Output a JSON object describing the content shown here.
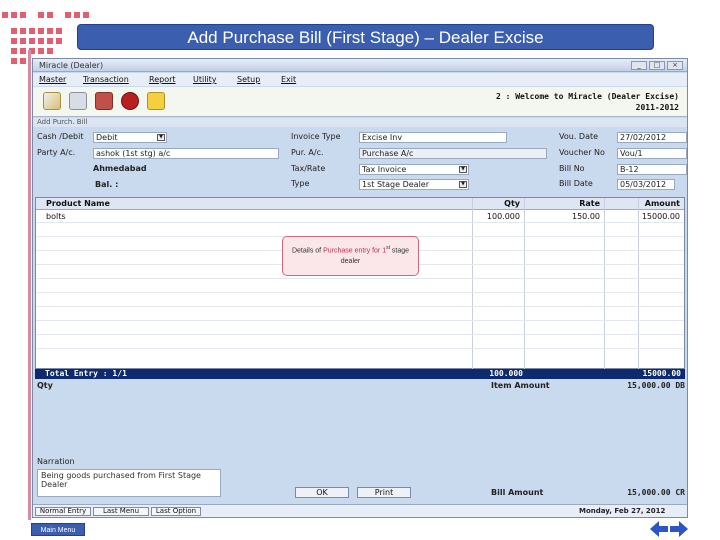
{
  "slide": {
    "title": "Add Purchase Bill (First Stage) – Dealer Excise",
    "main_menu": "Main Menu"
  },
  "window": {
    "title": "Miracle (Dealer)"
  },
  "menu": [
    "Master",
    "Transaction",
    "Report",
    "Utility",
    "Setup",
    "Exit"
  ],
  "welcome": {
    "line1": "2 : Welcome to Miracle (Dealer Excise)",
    "line2": "2011-2012"
  },
  "form": {
    "subtitle": "Add Purch. Bill",
    "cash_debit_label": "Cash /Debit",
    "cash_debit_value": "Debit",
    "party_label": "Party A/c.",
    "party_value": "ashok (1st stg) a/c",
    "city": "Ahmedabad",
    "bal_label": "Bal. :",
    "invoice_type_label": "Invoice Type",
    "invoice_type_value": "Excise Inv",
    "pur_ac_label": "Pur. A/c.",
    "pur_ac_value": "Purchase A/c",
    "tax_rate_label": "Tax/Rate",
    "tax_rate_value": "Tax Invoice",
    "type_label": "Type",
    "type_value": "1st Stage Dealer",
    "vou_date_label": "Vou. Date",
    "vou_date_value": "27/02/2012",
    "voucher_no_label": "Voucher No",
    "voucher_no_value": "Vou/1",
    "bill_no_label": "Bill No",
    "bill_no_value": "B-12",
    "bill_date_label": "Bill Date",
    "bill_date_value": "05/03/2012"
  },
  "grid": {
    "headers": [
      "Product Name",
      "Qty",
      "Rate",
      "Amount"
    ],
    "rows": [
      {
        "product": "bolts",
        "qty": "100.000",
        "rate": "150.00",
        "amount": "15000.00"
      }
    ]
  },
  "callout": {
    "line1a": "Details of ",
    "line1b": "Purchase entry for 1",
    "line1c": " stage dealer",
    "sup": "st"
  },
  "totals": {
    "entry_label": "Total Entry : 1/1",
    "qty": "100.000",
    "amount": "15000.00"
  },
  "summary": {
    "qty_label": "Qty",
    "item_amount_label": "Item Amount",
    "item_amount_value": "15,000.00 DB",
    "narration_label": "Narration",
    "narration_value": "Being goods purchased from First Stage Dealer",
    "bill_amount_label": "Bill Amount",
    "bill_amount_value": "15,000.00 CR"
  },
  "buttons": {
    "ok": "OK",
    "print": "Print"
  },
  "status": {
    "tabs": [
      "Normal Entry",
      "Last Menu",
      "Last Option"
    ],
    "date": "Monday, Feb 27, 2012"
  },
  "colors": {
    "banner": "#3b5fae",
    "total_bar": "#0e2a6e",
    "window_bg": "#c9d9ee"
  }
}
